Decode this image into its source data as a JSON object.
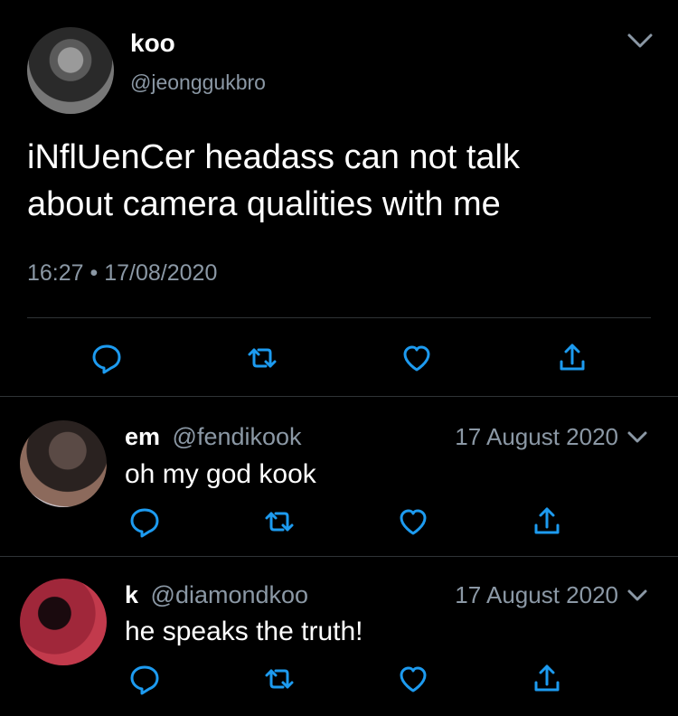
{
  "main_tweet": {
    "name": "koo",
    "handle": "@jeonggukbro",
    "text_line1": "iNflUenCer headass can not talk",
    "text_line2": "about camera qualities with me",
    "time": "16:27",
    "separator": "•",
    "date": "17/08/2020"
  },
  "replies": [
    {
      "name": "em",
      "handle": "@fendikook",
      "date": "17 August 2020",
      "text": "oh my god kook"
    },
    {
      "name": "k",
      "handle": "@diamondkoo",
      "date": "17 August 2020",
      "text": "he speaks the truth!"
    }
  ],
  "icons": {
    "reply": "reply-icon",
    "retweet": "retweet-icon",
    "like": "heart-icon",
    "share": "share-icon",
    "menu": "chevron-down-icon"
  },
  "colors": {
    "background": "#000000",
    "text": "#ffffff",
    "secondary": "#8b98a5",
    "divider": "#2f3336"
  }
}
